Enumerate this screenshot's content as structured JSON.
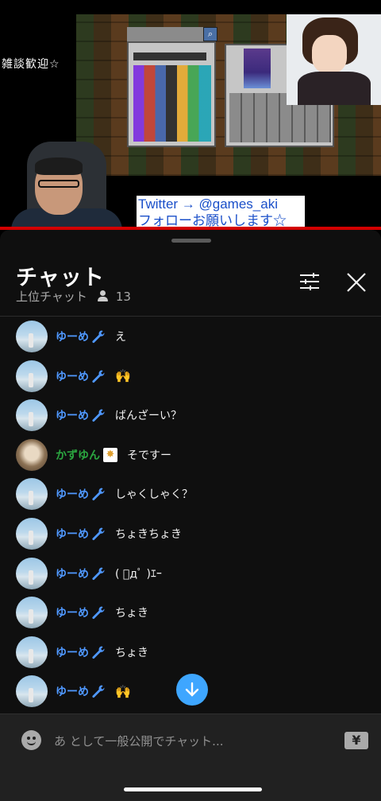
{
  "video": {
    "caption": "雑談歓迎☆",
    "overlay_line1": "Twitter → @games_aki",
    "overlay_line2": "フォローお願いします☆",
    "progress_fraction": 1.0
  },
  "chat": {
    "title": "チャット",
    "mode": "上位チャット",
    "viewer_count": "13",
    "icons": {
      "viewers": "person-icon",
      "filter": "tune-icon",
      "close": "close-icon",
      "scroll": "arrow-down-icon"
    },
    "messages": [
      {
        "author": "ゆーめ",
        "badge": "wrench",
        "text": "え",
        "avatar": "sky"
      },
      {
        "author": "ゆーめ",
        "badge": "wrench",
        "text": "🙌",
        "avatar": "sky"
      },
      {
        "author": "ゆーめ",
        "badge": "wrench",
        "text": "ばんざーい？",
        "avatar": "sky"
      },
      {
        "author": "かずゆん",
        "badge": "member",
        "text": "そですー",
        "avatar": "cat"
      },
      {
        "author": "ゆーめ",
        "badge": "wrench",
        "text": "しゃくしゃく？",
        "avatar": "sky"
      },
      {
        "author": "ゆーめ",
        "badge": "wrench",
        "text": "ちょきちょき",
        "avatar": "sky"
      },
      {
        "author": "ゆーめ",
        "badge": "wrench",
        "text": "( ﾟдﾟ )ｴｰ",
        "avatar": "sky"
      },
      {
        "author": "ゆーめ",
        "badge": "wrench",
        "text": "ちょき",
        "avatar": "sky"
      },
      {
        "author": "ゆーめ",
        "badge": "wrench",
        "text": "ちょき",
        "avatar": "sky"
      },
      {
        "author": "ゆーめ",
        "badge": "wrench",
        "text": "🙌",
        "avatar": "sky"
      }
    ]
  },
  "input": {
    "placeholder": "あ として一般公開でチャット...",
    "yen_label": "¥"
  },
  "colors": {
    "moderator_name": "#4f98ff",
    "member_name": "#2ba640",
    "accent": "#3ea6ff",
    "progress": "#d30000"
  }
}
